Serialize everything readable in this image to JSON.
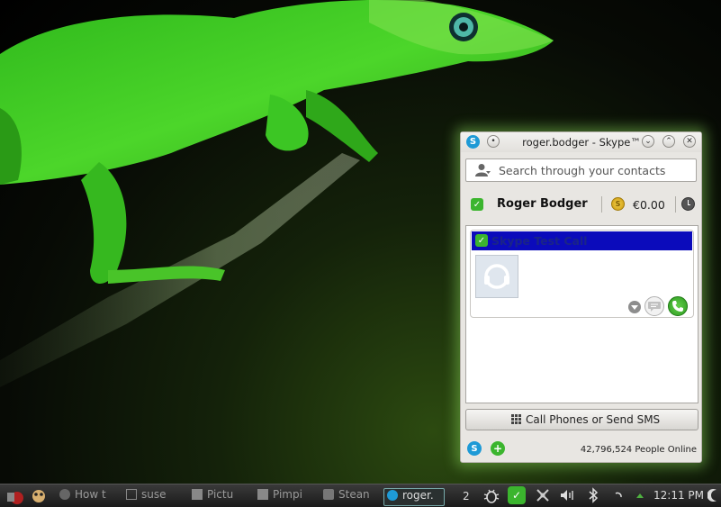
{
  "window": {
    "title": "roger.bodger - Skype™",
    "search_placeholder": "Search through your contacts",
    "user_name": "Roger Bodger",
    "credit": "€0.00",
    "contact_name": "Skype Test Call",
    "call_phones_label": "Call Phones or Send SMS",
    "people_online": "42,796,524 People Online"
  },
  "taskbar": {
    "tasks": [
      "How t",
      "suse",
      "Pictu",
      "Pimpi",
      "Stean",
      "roger."
    ],
    "desktop_number": "2",
    "clock": "12:11 PM"
  },
  "colors": {
    "skype_blue": "#1e9ad6",
    "status_green": "#3bb52e",
    "selection_blue": "#0b0bbb"
  }
}
